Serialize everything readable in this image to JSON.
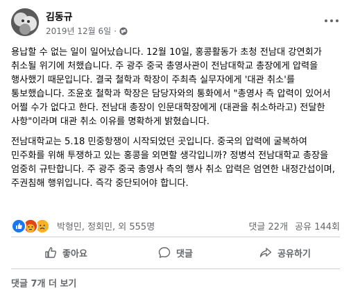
{
  "header": {
    "author": "김동규",
    "date": "2019년 12월 6일",
    "separator": "·",
    "icons": {
      "avatar": "profile-photo",
      "audience": "globe-icon",
      "more": "more-options-icon"
    }
  },
  "post": {
    "paragraphs": [
      "용납할 수 없는 일이 일어났습니다. 12월 10일, 홍콩활동가 초청 전남대 강연회가 취소될 위기에 처했습니다. 주 광주 중국 총영사관이 전남대학교 총장에게 압력을 행사했기 때문입니다. 결국 철학과 학장이 주최측 실무자에게 '대관 취소'를 통보했습니다. 조윤호 철학과 학장은 담당자와의 통화에서 \"총영사 측 압력이 있어서 어쩔 수가 없다고 한다. 전남대 총장이 인문대학장에게 (대관을 취소하라고) 전달한 사항\"이라며 대관 취소 이유를 명확하게 밝혔습니다.",
      "전남대학교는 5.18 민중항쟁이 시작되었던 곳입니다. 중국의 압력에 굴복하여 민주화를 위해 투쟁하고 있는 홍콩을 외면할 생각입니까? 정병석 전남대학교 총장을 엄중히 규탄합니다. 주 광주 중국 총영사 측의 행사 취소 압력은 엄연한 내정간섭이며, 주권침해 행위입니다. 즉각 중단되어야 합니다."
    ]
  },
  "stats": {
    "reactions_text": "박형민, 정회민, 외 555명",
    "comments": "댓글 22개",
    "shares": "공유 144회",
    "reaction_icons": [
      "like-reaction-icon",
      "angry-reaction-icon",
      "sad-reaction-icon"
    ],
    "reaction_colors": [
      "#1877f2",
      "#e9710f",
      "#f7b125"
    ]
  },
  "actions": {
    "like": "좋아요",
    "comment": "댓글",
    "share": "공유하기"
  },
  "comments": {
    "more_label": "댓글 7개 더 보기"
  }
}
